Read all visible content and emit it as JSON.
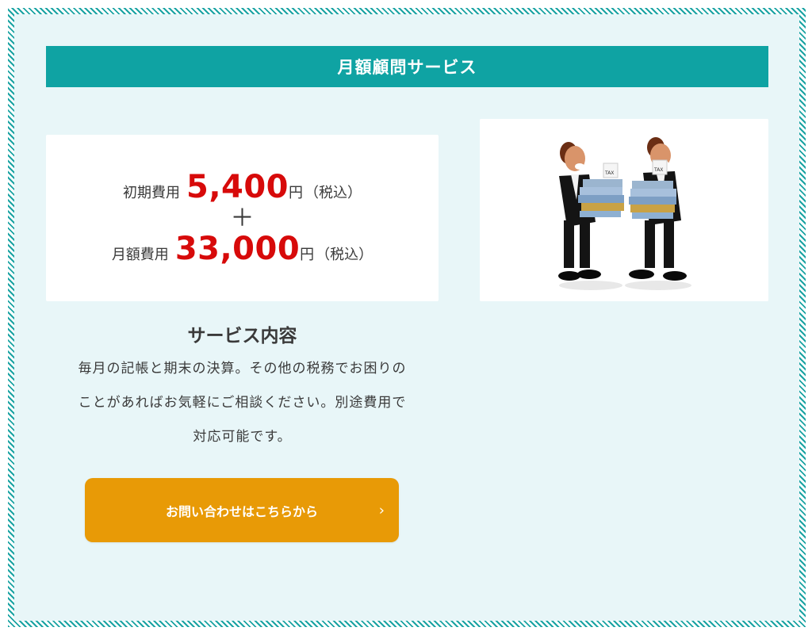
{
  "banner": {
    "title": "月額顧問サービス"
  },
  "pricing": {
    "initial": {
      "label": "初期費用",
      "amount": "5,400",
      "unit": "円",
      "tax": "（税込）"
    },
    "plus": "＋",
    "monthly": {
      "label": "月額費用",
      "amount": "33,000",
      "unit": "円",
      "tax": "（税込）"
    }
  },
  "service": {
    "title": "サービス内容",
    "desc_line1": "毎月の記帳と期末の決算。その他の税務でお困りの",
    "desc_line2": "ことがあればお気軽にご相談ください。別途費用で",
    "desc_line3": "対応可能です。"
  },
  "cta": {
    "label": "お問い合わせはこちらから",
    "icon": "chevron-right-icon"
  },
  "photo": {
    "tag_left": "TAX",
    "tag_right": "TAX"
  },
  "colors": {
    "banner": "#0fa3a3",
    "price": "#d70a0a",
    "button": "#e89a06",
    "background": "#e8f6f8"
  }
}
